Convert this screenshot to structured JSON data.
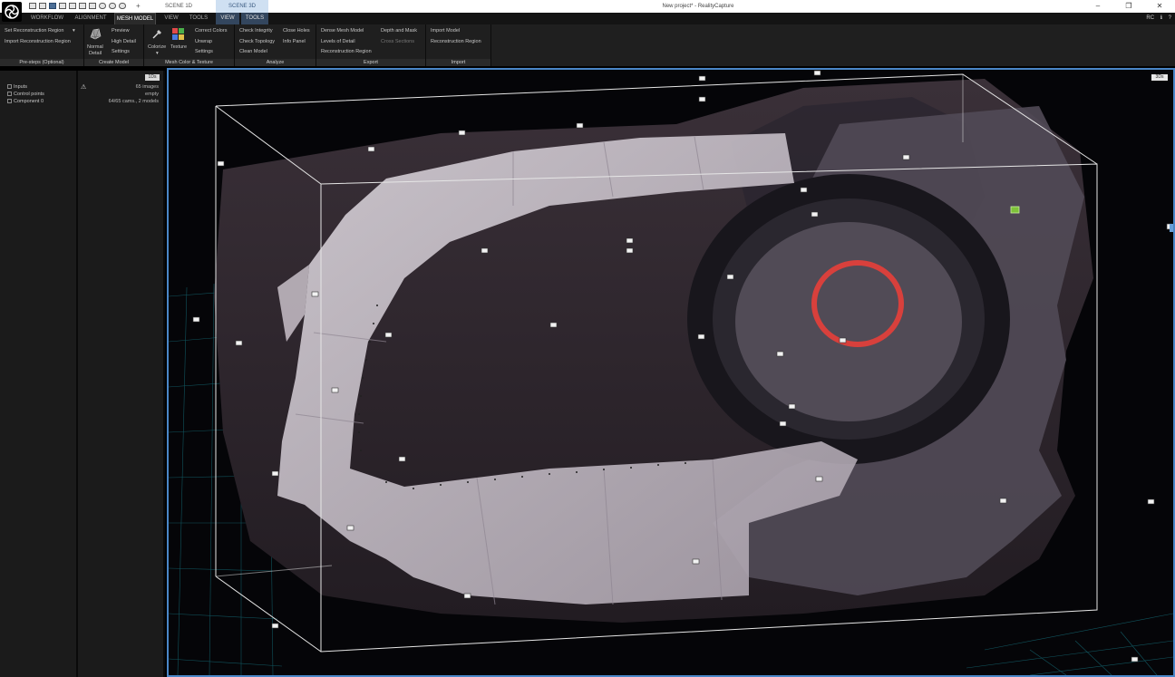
{
  "window": {
    "title": "New project* - RealityCapture",
    "controls": [
      "–",
      "❐",
      "✕"
    ]
  },
  "scene_tabs": {
    "add_label": "+",
    "tab1": "SCENE 1D",
    "tab2": "SCENE 3D"
  },
  "menu": {
    "workflow": "WORKFLOW",
    "alignment": "ALIGNMENT",
    "mesh_model": "MESH MODEL",
    "view": "VIEW",
    "tools": "TOOLS",
    "view2": "VIEW",
    "tools2": "TOOLS",
    "user": "RC",
    "info": "ℹ",
    "help": "?"
  },
  "ribbon": {
    "presteps": {
      "label": "Pre-steps (Optional)",
      "set_region": "Set Reconstruction Region",
      "import_region": "Import Reconstruction Region",
      "dropdown": "▾"
    },
    "create_model": {
      "label": "Create Model",
      "normal_detail_line1": "Normal",
      "normal_detail_line2": "Detail",
      "preview": "Preview",
      "high_detail": "High Detail",
      "settings": "Settings"
    },
    "color_texture": {
      "label": "Mesh Color & Texture",
      "colorize": "Colorize",
      "colorize_arrow": "▾",
      "texture": "Texture",
      "correct_colors": "Correct Colors",
      "unwrap": "Unwrap",
      "settings": "Settings"
    },
    "analyze": {
      "label": "Analyze",
      "check_integrity": "Check Integrity",
      "check_topology": "Check Topology",
      "clean_model": "Clean Model",
      "close_holes": "Close Holes",
      "info_panel": "Info Panel"
    },
    "export": {
      "label": "Export",
      "dense_mesh": "Dense Mesh Model",
      "levels_of_detail": "Levels of Detail",
      "reconstruction_region": "Reconstruction Region",
      "depth_mask": "Depth and Mask",
      "cross_sections": "Cross Sections"
    },
    "import": {
      "label": "Import",
      "import_model": "Import Model",
      "reconstruction_region": "Reconstruction Region"
    }
  },
  "left_panel": {
    "view_button": "1Ds",
    "warning_icon": "⚠",
    "tree": [
      {
        "label": "Inputs",
        "value": "65 images"
      },
      {
        "label": "Control points",
        "value": "empty"
      },
      {
        "label": "Component 0",
        "value": "64/65 cams., 2 models"
      }
    ]
  },
  "viewport": {
    "view_button": "3Ds"
  },
  "colors": {
    "accent": "#4a86c7",
    "ribbon_bg": "#1f1f1f",
    "menu_bg": "#141414",
    "scene_tab_active": "#cfe0f2",
    "grid": "#1fb3c4",
    "camera_selected": "#7ec23a",
    "marker_ring": "#d8403c"
  }
}
